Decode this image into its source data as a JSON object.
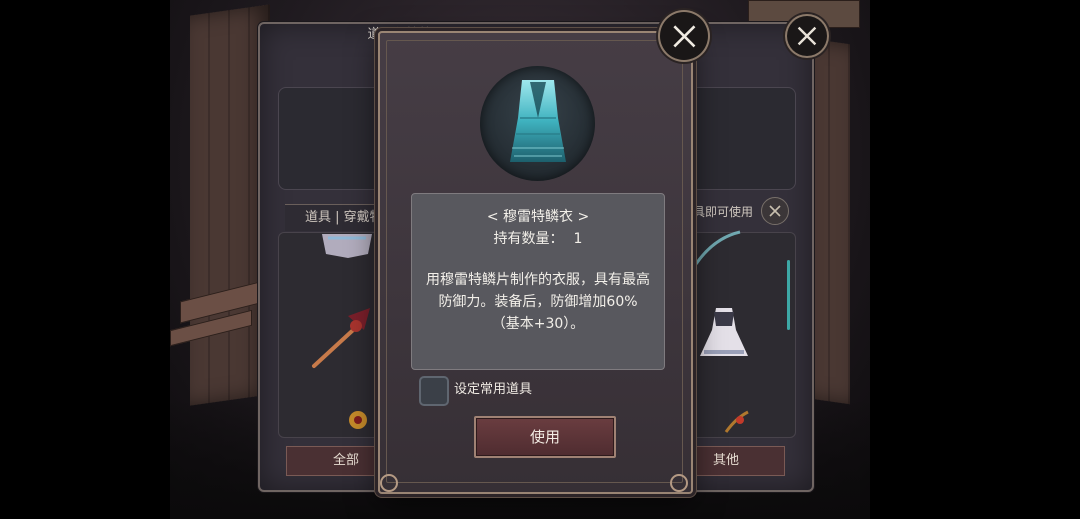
{
  "back_panel": {
    "title": "道具保管箱",
    "tab_left": "道具 | 穿戴物",
    "tab_right": "具即可使用",
    "btn_all": "全部",
    "btn_other": "其他"
  },
  "item": {
    "name": "< 穆雷特鳞衣 >",
    "count_label": "持有数量：",
    "count_value": "1",
    "description": "用穆雷特鳞片制作的衣服，具有最高防御力。装备后，防御增加60%（基本+30）。",
    "icon": "teal-scale-robe-icon"
  },
  "favorite_label": "设定常用道具",
  "use_button": "使用",
  "colors": {
    "modal_bg": "#3f373e",
    "desc_bg": "#58585e",
    "use_button": "#5e3437",
    "accent_teal": "#3da8a6"
  }
}
